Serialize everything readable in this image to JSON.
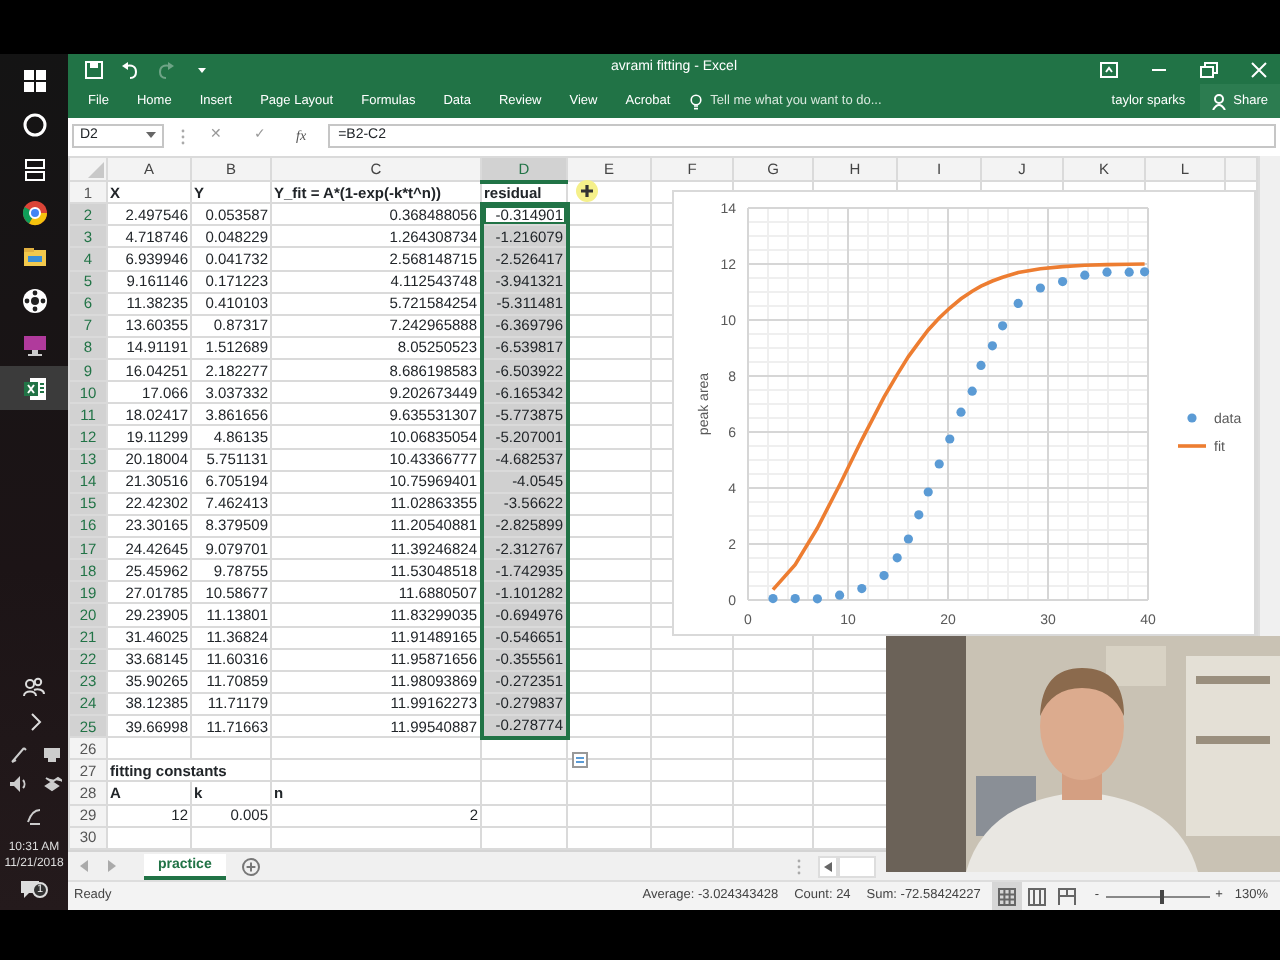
{
  "taskbar": {
    "apps": [
      {
        "kind": "start",
        "active": false
      },
      {
        "kind": "search",
        "active": false
      },
      {
        "kind": "taskview",
        "active": false
      },
      {
        "kind": "browser",
        "active": false
      },
      {
        "kind": "folder",
        "active": false
      },
      {
        "kind": "disc",
        "active": false
      },
      {
        "kind": "monitor",
        "active": false
      },
      {
        "kind": "sheet",
        "active": true
      }
    ],
    "tray": {
      "time": "10:31 AM",
      "date": "11/21/2018",
      "notifications": "1"
    }
  },
  "window": {
    "title": "avrami fitting - Excel",
    "quick_access": [
      {
        "kind": "save",
        "disabled": false
      },
      {
        "kind": "undo",
        "disabled": false
      },
      {
        "kind": "redo",
        "disabled": true
      },
      {
        "kind": "customize",
        "disabled": false
      }
    ]
  },
  "ribbon": {
    "tabs": [
      "File",
      "Home",
      "Insert",
      "Page Layout",
      "Formulas",
      "Data",
      "Review",
      "View",
      "Acrobat"
    ],
    "tell_me": {
      "placeholder": "Tell me what you want to do..."
    },
    "user": "taylor sparks",
    "share": "Share"
  },
  "formula_bar": {
    "name_box": "D2",
    "cancel": "✕",
    "enter": "✓",
    "function_label": "fx",
    "formula": "=B2-C2"
  },
  "columns": [
    {
      "label": "A",
      "selected": false
    },
    {
      "label": "B",
      "selected": false
    },
    {
      "label": "C",
      "selected": false
    },
    {
      "label": "D",
      "selected": true
    },
    {
      "label": "E",
      "selected": false
    },
    {
      "label": "F",
      "selected": false
    },
    {
      "label": "G",
      "selected": false
    },
    {
      "label": "H",
      "selected": false
    },
    {
      "label": "I",
      "selected": false
    },
    {
      "label": "J",
      "selected": false
    },
    {
      "label": "K",
      "selected": false
    },
    {
      "label": "L",
      "selected": false
    }
  ],
  "rows": [
    {
      "number": "1",
      "kind": "label",
      "selected": false,
      "cells": [
        "X",
        "Y",
        "Y_fit = A*(1-exp(-k*t^n))",
        "residual"
      ]
    },
    {
      "number": "2",
      "kind": "data",
      "selected": true,
      "active": true,
      "cells": [
        "2.497546",
        "0.053587",
        "0.368488056",
        "-0.314901"
      ]
    },
    {
      "number": "3",
      "kind": "data",
      "selected": true,
      "cells": [
        "4.718746",
        "0.048229",
        "1.264308734",
        "-1.216079"
      ]
    },
    {
      "number": "4",
      "kind": "data",
      "selected": true,
      "cells": [
        "6.939946",
        "0.041732",
        "2.568148715",
        "-2.526417"
      ]
    },
    {
      "number": "5",
      "kind": "data",
      "selected": true,
      "cells": [
        "9.161146",
        "0.171223",
        "4.112543748",
        "-3.941321"
      ]
    },
    {
      "number": "6",
      "kind": "data",
      "selected": true,
      "cells": [
        "11.38235",
        "0.410103",
        "5.721584254",
        "-5.311481"
      ]
    },
    {
      "number": "7",
      "kind": "data",
      "selected": true,
      "cells": [
        "13.60355",
        "0.87317",
        "7.242965888",
        "-6.369796"
      ]
    },
    {
      "number": "8",
      "kind": "data",
      "selected": true,
      "cells": [
        "14.91191",
        "1.512689",
        "8.05250523",
        "-6.539817"
      ]
    },
    {
      "number": "9",
      "kind": "data",
      "selected": true,
      "cells": [
        "16.04251",
        "2.182277",
        "8.686198583",
        "-6.503922"
      ]
    },
    {
      "number": "10",
      "kind": "data",
      "selected": true,
      "cells": [
        "17.066",
        "3.037332",
        "9.202673449",
        "-6.165342"
      ]
    },
    {
      "number": "11",
      "kind": "data",
      "selected": true,
      "cells": [
        "18.02417",
        "3.861656",
        "9.635531307",
        "-5.773875"
      ]
    },
    {
      "number": "12",
      "kind": "data",
      "selected": true,
      "cells": [
        "19.11299",
        "4.86135",
        "10.06835054",
        "-5.207001"
      ]
    },
    {
      "number": "13",
      "kind": "data",
      "selected": true,
      "cells": [
        "20.18004",
        "5.751131",
        "10.43366777",
        "-4.682537"
      ]
    },
    {
      "number": "14",
      "kind": "data",
      "selected": true,
      "cells": [
        "21.30516",
        "6.705194",
        "10.75969401",
        "-4.0545"
      ]
    },
    {
      "number": "15",
      "kind": "data",
      "selected": true,
      "cells": [
        "22.42302",
        "7.462413",
        "11.02863355",
        "-3.56622"
      ]
    },
    {
      "number": "16",
      "kind": "data",
      "selected": true,
      "cells": [
        "23.30165",
        "8.379509",
        "11.20540881",
        "-2.825899"
      ]
    },
    {
      "number": "17",
      "kind": "data",
      "selected": true,
      "cells": [
        "24.42645",
        "9.079701",
        "11.39246824",
        "-2.312767"
      ]
    },
    {
      "number": "18",
      "kind": "data",
      "selected": true,
      "cells": [
        "25.45962",
        "9.78755",
        "11.53048518",
        "-1.742935"
      ]
    },
    {
      "number": "19",
      "kind": "data",
      "selected": true,
      "cells": [
        "27.01785",
        "10.58677",
        "11.6880507",
        "-1.101282"
      ]
    },
    {
      "number": "20",
      "kind": "data",
      "selected": true,
      "cells": [
        "29.23905",
        "11.13801",
        "11.83299035",
        "-0.694976"
      ]
    },
    {
      "number": "21",
      "kind": "data",
      "selected": true,
      "cells": [
        "31.46025",
        "11.36824",
        "11.91489165",
        "-0.546651"
      ]
    },
    {
      "number": "22",
      "kind": "data",
      "selected": true,
      "cells": [
        "33.68145",
        "11.60316",
        "11.95871656",
        "-0.355561"
      ]
    },
    {
      "number": "23",
      "kind": "data",
      "selected": true,
      "cells": [
        "35.90265",
        "11.70859",
        "11.98093869",
        "-0.272351"
      ]
    },
    {
      "number": "24",
      "kind": "data",
      "selected": true,
      "cells": [
        "38.12385",
        "11.71179",
        "11.99162273",
        "-0.279837"
      ]
    },
    {
      "number": "25",
      "kind": "data",
      "selected": true,
      "cells": [
        "39.66998",
        "11.71663",
        "11.99540887",
        "-0.278774"
      ]
    },
    {
      "number": "26",
      "kind": "data",
      "selected": false,
      "cells": []
    },
    {
      "number": "27",
      "kind": "label",
      "selected": false,
      "cells": [
        "fitting constants"
      ]
    },
    {
      "number": "28",
      "kind": "label",
      "selected": false,
      "cells": [
        "A",
        "k",
        "n"
      ]
    },
    {
      "number": "29",
      "kind": "data",
      "selected": false,
      "cells": [
        "12",
        "0.005",
        "2"
      ]
    },
    {
      "number": "30",
      "kind": "data",
      "selected": false,
      "cells": []
    }
  ],
  "chart": {
    "chart_data": {
      "type": "scatter",
      "grid": true,
      "legend": "right",
      "ylabel": "peak area",
      "xlim": [
        0,
        40
      ],
      "ylim": [
        0,
        14
      ],
      "xticks": [
        0,
        10,
        20,
        30,
        40
      ],
      "yticks": [
        0,
        2,
        4,
        6,
        8,
        10,
        12,
        14
      ],
      "x": [
        2.5,
        4.72,
        6.94,
        9.16,
        11.38,
        13.6,
        14.91,
        16.04,
        17.07,
        18.02,
        19.11,
        20.18,
        21.31,
        22.42,
        23.3,
        24.43,
        25.46,
        27.02,
        29.24,
        31.46,
        33.68,
        35.9,
        38.12,
        39.67
      ],
      "series": [
        {
          "name": "data",
          "color": "#5b9bd5",
          "values": [
            0.05,
            0.05,
            0.04,
            0.17,
            0.41,
            0.87,
            1.51,
            2.18,
            3.04,
            3.86,
            4.86,
            5.75,
            6.71,
            7.46,
            8.38,
            9.08,
            9.79,
            10.59,
            11.14,
            11.37,
            11.6,
            11.71,
            11.71,
            11.72
          ]
        },
        {
          "name": "fit",
          "color": "#ed7d31",
          "type": "line",
          "values": [
            0.37,
            1.26,
            2.57,
            4.11,
            5.72,
            7.24,
            8.05,
            8.69,
            9.2,
            9.64,
            10.07,
            10.43,
            10.76,
            11.03,
            11.21,
            11.39,
            11.53,
            11.69,
            11.83,
            11.91,
            11.96,
            11.98,
            11.99,
            12.0
          ]
        }
      ]
    }
  },
  "sheets": [
    {
      "label": "practice",
      "selected": true
    }
  ],
  "status_bar": {
    "state": "Ready",
    "average": "Average: -3.024343428",
    "count": "Count: 24",
    "sum": "Sum: -72.58424227",
    "views": [
      {
        "kind": "normal",
        "selected": true
      },
      {
        "kind": "layout",
        "selected": false
      },
      {
        "kind": "breaks",
        "selected": false
      }
    ],
    "zoom_out": "-",
    "zoom_in": "+",
    "zoom": {
      "level": 0.55,
      "reading": "130%"
    }
  }
}
